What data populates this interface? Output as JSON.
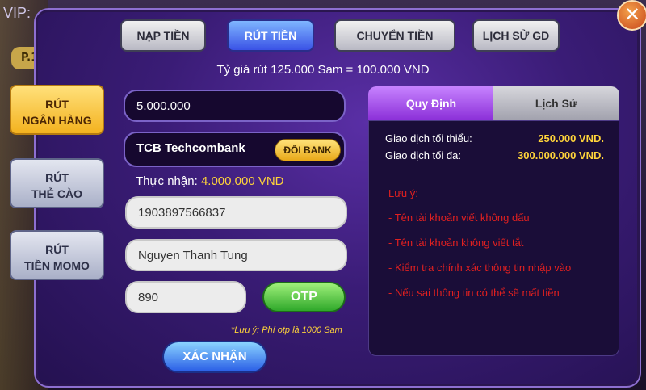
{
  "background": {
    "vip_label": "VIP:",
    "p1_label": "P.1"
  },
  "tabs": [
    {
      "label": "NẠP TIỀN",
      "active": false
    },
    {
      "label": "RÚT TIỀN",
      "active": true
    },
    {
      "label": "CHUYỂN TIỀN",
      "active": false
    },
    {
      "label": "LỊCH SỬ GD",
      "active": false
    }
  ],
  "close_icon": "close-icon",
  "rate_text": "Tỷ giá rút 125.000 Sam = 100.000 VND",
  "side_menu": [
    {
      "line1": "RÚT",
      "line2": "NGÂN HÀNG",
      "active": true
    },
    {
      "line1": "RÚT",
      "line2": "THẺ CÀO",
      "active": false
    },
    {
      "line1": "RÚT",
      "line2": "TIỀN MOMO",
      "active": false
    }
  ],
  "form": {
    "amount": "5.000.000",
    "bank_name": "TCB Techcombank",
    "change_bank_label": "ĐỔI BANK",
    "received_label": "Thực nhận:",
    "received_amount": "4.000.000 VND",
    "account_number": "1903897566837",
    "account_name": "Nguyen Thanh Tung",
    "otp_value": "890",
    "otp_button": "OTP",
    "fee_note": "*Lưu ý: Phí otp là 1000 Sam",
    "confirm_button": "XÁC NHẬN"
  },
  "right_panel": {
    "tab_rules": "Quy Định",
    "tab_history": "Lịch Sử",
    "min_label": "Giao dịch tối thiểu:",
    "min_value": "250.000 VND.",
    "max_label": "Giao dịch tối đa:",
    "max_value": "300.000.000 VND.",
    "note_title": "Lưu ý:",
    "notes": [
      "- Tên tài khoản viết không dấu",
      "- Tên tài khoản không viết tắt",
      "- Kiểm tra chính xác thông tin nhập vào",
      "- Nếu sai thông tin có thể sẽ mất tiền"
    ]
  }
}
